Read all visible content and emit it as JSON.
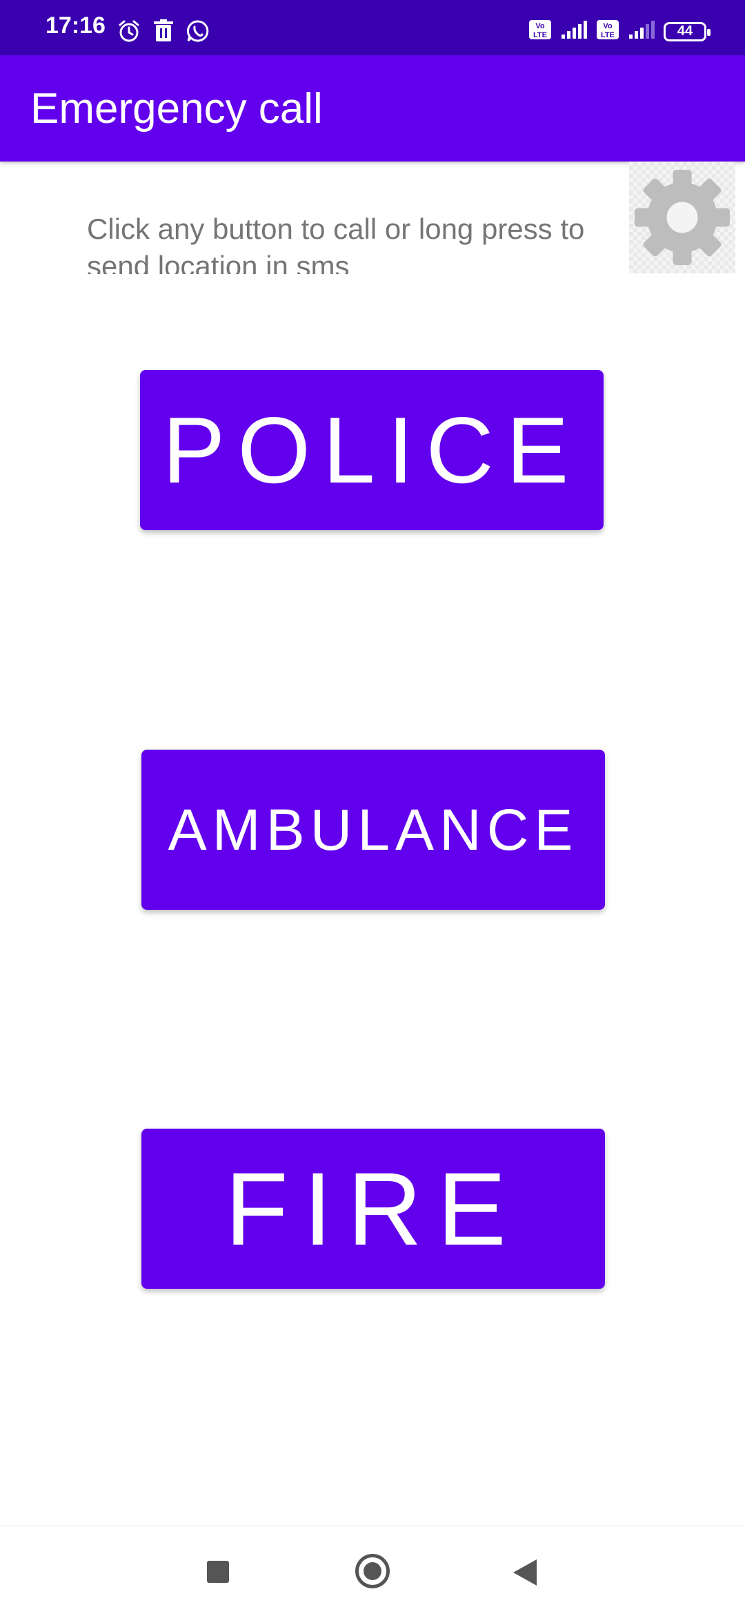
{
  "status_bar": {
    "time": "17:16",
    "left_icons": [
      "alarm-icon",
      "trash-icon",
      "whatsapp-icon"
    ],
    "right_icons": [
      "volte-icon",
      "signal-icon",
      "volte-icon",
      "signal-icon"
    ],
    "battery_level": "44"
  },
  "app_bar": {
    "title": "Emergency call",
    "color": "#6200ee"
  },
  "instructions": {
    "text": "Click any button to call or long press to send location in sms"
  },
  "settings": {
    "icon": "gear-icon",
    "color": "#bdbdbd"
  },
  "buttons": {
    "police": "POLICE",
    "ambulance": "AMBULANCE",
    "fire": "FIRE",
    "color": "#6200ee"
  },
  "nav_bar": {
    "icons": [
      "recent-apps-icon",
      "home-icon",
      "back-icon"
    ]
  }
}
